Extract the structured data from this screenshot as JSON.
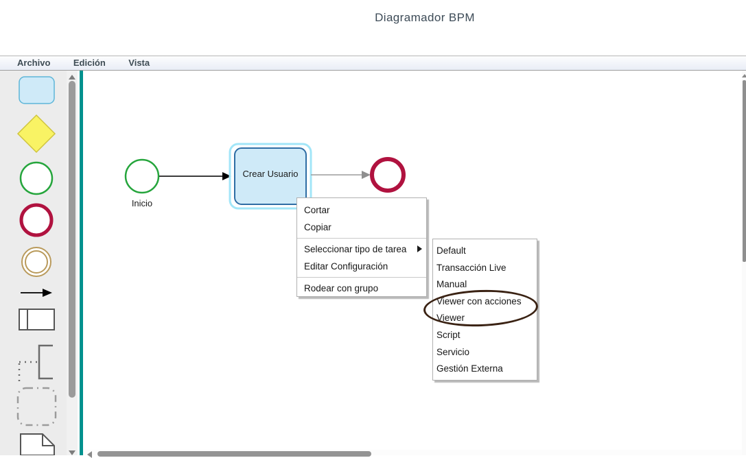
{
  "title": "Diagramador BPM",
  "menubar": {
    "items": [
      {
        "label": "Archivo"
      },
      {
        "label": "Edición"
      },
      {
        "label": "Vista"
      }
    ]
  },
  "palette": {
    "tools": [
      {
        "name": "task-tool"
      },
      {
        "name": "gateway-tool"
      },
      {
        "name": "start-event-tool"
      },
      {
        "name": "end-event-tool"
      },
      {
        "name": "intermediate-event-tool"
      },
      {
        "name": "sequence-flow-tool"
      },
      {
        "name": "lane-tool"
      },
      {
        "name": "link-tool"
      },
      {
        "name": "group-tool"
      },
      {
        "name": "data-object-tool"
      }
    ]
  },
  "diagram": {
    "start_label": "Inicio",
    "task_label": "Crear Usuario"
  },
  "context_menu": {
    "items": [
      {
        "label": "Cortar"
      },
      {
        "label": "Copiar"
      },
      {
        "label": "Seleccionar tipo de tarea",
        "has_submenu": true
      },
      {
        "label": "Editar Configuración"
      },
      {
        "label": "Rodear con grupo"
      }
    ]
  },
  "submenu": {
    "items": [
      {
        "label": "Default"
      },
      {
        "label": "Transacción Live"
      },
      {
        "label": "Manual"
      },
      {
        "label": "Viewer con acciones",
        "annotated": true
      },
      {
        "label": "Viewer",
        "annotated": true
      },
      {
        "label": "Script"
      },
      {
        "label": "Servicio"
      },
      {
        "label": "Gestión Externa"
      }
    ]
  },
  "colors": {
    "selection_outline": "#a2e6f8",
    "task_fill": "#cfeaf8",
    "task_border": "#2e6da4",
    "start_event_stroke": "#25a53c",
    "end_event_stroke": "#b0123f",
    "intermediate_event_stroke": "#b99a5b",
    "gateway_fill": "#f9f364",
    "gateway_border": "#cfc43e",
    "canvas_divider": "#00918e",
    "annotation": "#3a2213"
  }
}
